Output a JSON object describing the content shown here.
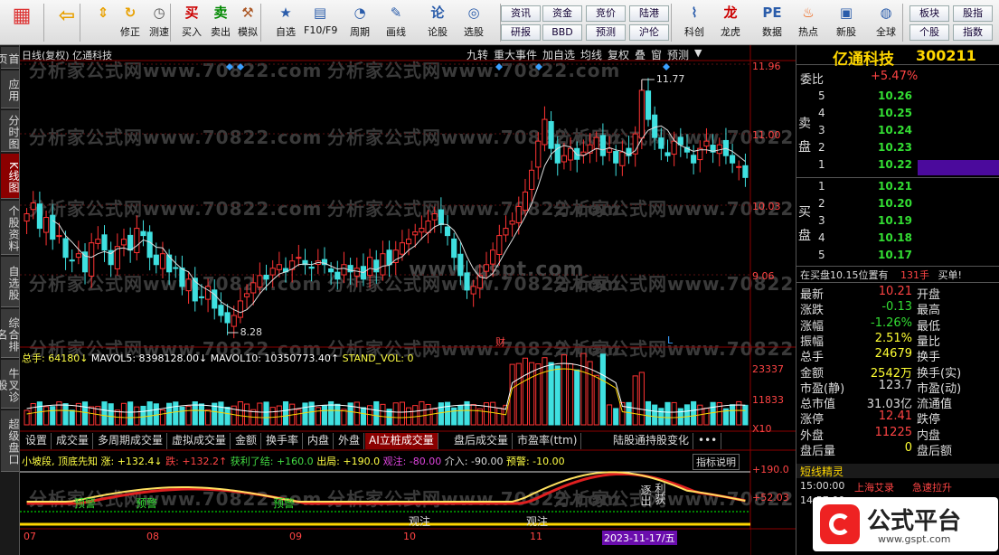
{
  "toolbar": {
    "buttons": [
      {
        "label": "",
        "icon": "grid-icon",
        "color": "#d33"
      },
      {
        "label": "",
        "icon": "back-arrow-icon",
        "color": "#e8a000"
      },
      {
        "label": "",
        "icon": "up-down-arrows-icon",
        "color": "#e8a000"
      },
      {
        "label": "修正",
        "icon": "refresh-icon",
        "color": "#e8a000"
      },
      {
        "label": "测速",
        "icon": "clock-icon",
        "color": "#555"
      },
      {
        "label": "买入",
        "icon": "buy-icon",
        "color": "#c00"
      },
      {
        "label": "卖出",
        "icon": "sell-icon",
        "color": "#080"
      },
      {
        "label": "模拟",
        "icon": "gavel-icon",
        "color": "#a52"
      },
      {
        "label": "自选",
        "icon": "star-icon",
        "color": "#2a5caa"
      },
      {
        "label": "F10/F9",
        "icon": "f10-icon",
        "color": "#2a5caa"
      },
      {
        "label": "周期",
        "icon": "cycle-icon",
        "color": "#2a5caa"
      },
      {
        "label": "画线",
        "icon": "pencil-icon",
        "color": "#2a5caa"
      },
      {
        "label": "论股",
        "icon": "chat-icon",
        "color": "#2a5caa"
      },
      {
        "label": "选股",
        "icon": "select-icon",
        "color": "#2a5caa"
      },
      {
        "label": "科创",
        "icon": "chart-icon",
        "color": "#2a5caa"
      },
      {
        "label": "龙虎",
        "icon": "dragon-icon",
        "color": "#c00"
      },
      {
        "label": "数据",
        "icon": "pe-icon",
        "color": "#2a5caa"
      },
      {
        "label": "热点",
        "icon": "fire-icon",
        "color": "#e50"
      },
      {
        "label": "新股",
        "icon": "ipo-icon",
        "color": "#2a5caa"
      },
      {
        "label": "全球",
        "icon": "globe-icon",
        "color": "#2a5caa"
      }
    ],
    "small_buttons": [
      "资讯",
      "资金",
      "竞价",
      "陆港",
      "研报",
      "BBD",
      "预测",
      "沪伦",
      "板块",
      "股指",
      "个股",
      "指数"
    ]
  },
  "left_tabs": [
    "首页",
    "应用",
    "分时图",
    "K线图",
    "个股资料",
    "自选股",
    "综合排名",
    "牛叉诊股",
    "超级盘口"
  ],
  "chart": {
    "header_left": "日线(复权)  亿通科技",
    "header_right": [
      "九转",
      "重大事件",
      "加自选",
      "均线",
      "复权",
      "叠",
      "窗",
      "预测"
    ],
    "price_axis": [
      "11.96",
      "11.00",
      "10.03",
      "9.06"
    ],
    "high_label": "11.77",
    "low_label": "8.28",
    "vol_header": {
      "a": "总手: 64180↓",
      "b": "MAVOL5: 8398128.00↓",
      "c": "MAVOL10: 10350773.40↑",
      "d": "STAND_VOL: 0"
    },
    "vol_axis": [
      "23337",
      "11833",
      "X10"
    ],
    "marker_cai": "财",
    "marker_l": "L",
    "watermark1": "分析家公式网www.70822.com",
    "watermark2": "www.gspt.com",
    "sub_tabs": [
      "设置",
      "成交量",
      "多周期成交量",
      "虚拟成交量",
      "金额",
      "换手率",
      "内盘",
      "外盘",
      "AI立桩成交量",
      "盘后成交量",
      "市盈率(ttm)",
      "陆股通持股变化",
      "•••"
    ],
    "ind_header": {
      "a": "小坡段, 顶底先知 涨: +132.4↓",
      "b": "跌: +132.2↑",
      "c": "获利了结: +160.0",
      "d": "出局: +190.0",
      "e": "观注: -80.00",
      "f": "介入: -90.00",
      "g": "预警: -10.00",
      "h": "指标说明"
    },
    "ind_axis": [
      "+190.0",
      "+52.03"
    ],
    "ind_labels": {
      "yujing": "预警",
      "guanzhu": "观注",
      "chu": "逐出",
      "zhi": "利获"
    },
    "date_axis": [
      "07",
      "08",
      "09",
      "10",
      "11"
    ],
    "current_date": "2023-11-17/五"
  },
  "candles": [
    9.9,
    10.05,
    9.7,
    9.85,
    9.55,
    9.6,
    9.3,
    9.25,
    9.35,
    9.1,
    9.5,
    9.55,
    9.4,
    9.2,
    9.45,
    9.55,
    9.4,
    9.7,
    9.6,
    9.3,
    9.2,
    9.35,
    9.1,
    9.15,
    8.9,
    9.0,
    8.7,
    8.75,
    8.9,
    8.6,
    8.5,
    8.4,
    8.5,
    8.7,
    8.8,
    8.95,
    9.05,
    9.0,
    9.15,
    9.2,
    9.1,
    9.25,
    9.3,
    9.2,
    9.15,
    9.25,
    9.2,
    9.1,
    9.0,
    9.2,
    9.1,
    9.15,
    9.0,
    9.3,
    9.1,
    9.35,
    9.2,
    9.4,
    9.5,
    9.55,
    9.65,
    9.7,
    9.8,
    9.9,
    9.75,
    9.6,
    9.3,
    9.05,
    8.85,
    8.9,
    9.05,
    9.2,
    9.4,
    9.6,
    9.7,
    9.8,
    10.0,
    10.2,
    10.5,
    10.9,
    11.2,
    10.8,
    10.6,
    10.7,
    10.8,
    10.65,
    10.75,
    10.85,
    10.95,
    10.7,
    10.8,
    10.6,
    10.75,
    10.7,
    11.0,
    11.6,
    11.2,
    10.95,
    10.8,
    10.7,
    10.9,
    10.85,
    10.75,
    10.6,
    10.8,
    10.9,
    10.75,
    10.85,
    10.7,
    10.6,
    10.55,
    10.4
  ],
  "quote": {
    "name": "亿通科技",
    "code": "300211",
    "weibi_label": "委比",
    "weibi": "+5.47%",
    "sell_label": "卖盘",
    "buy_label": "买盘",
    "asks": [
      [
        "5",
        "10.26"
      ],
      [
        "4",
        "10.25"
      ],
      [
        "3",
        "10.24"
      ],
      [
        "2",
        "10.23"
      ],
      [
        "1",
        "10.22"
      ]
    ],
    "bids": [
      [
        "1",
        "10.21"
      ],
      [
        "2",
        "10.20"
      ],
      [
        "3",
        "10.19"
      ],
      [
        "4",
        "10.18"
      ],
      [
        "5",
        "10.17"
      ]
    ],
    "info_line": {
      "a": "在买盘10.15位置有",
      "b": "131手",
      "c": "买单!"
    },
    "rows": [
      {
        "l": "最新",
        "v": "10.21",
        "vc": "#ff4444",
        "r": "开盘",
        "rv": ""
      },
      {
        "l": "涨跌",
        "v": "-0.13",
        "vc": "#33dd33",
        "r": "最高",
        "rv": ""
      },
      {
        "l": "涨幅",
        "v": "-1.26%",
        "vc": "#33dd33",
        "r": "最低",
        "rv": ""
      },
      {
        "l": "振幅",
        "v": "2.51%",
        "vc": "#ffff33",
        "r": "量比",
        "rv": ""
      },
      {
        "l": "总手",
        "v": "24679",
        "vc": "#ffff33",
        "r": "换手",
        "rv": ""
      },
      {
        "l": "金额",
        "v": "2542万",
        "vc": "#ffff33",
        "r": "换手(实)",
        "rv": ""
      },
      {
        "l": "市盈(静)",
        "v": "123.7",
        "vc": "#ddd",
        "r": "市盈(动)",
        "rv": ""
      },
      {
        "l": "总市值",
        "v": "31.03亿",
        "vc": "#ddd",
        "r": "流通值",
        "rv": ""
      },
      {
        "l": "涨停",
        "v": "12.41",
        "vc": "#ff4444",
        "r": "跌停",
        "rv": ""
      },
      {
        "l": "外盘",
        "v": "11225",
        "vc": "#ff4444",
        "r": "内盘",
        "rv": ""
      },
      {
        "l": "盘后量",
        "v": "0",
        "vc": "#ffff33",
        "r": "盘后额",
        "rv": ""
      }
    ],
    "sprite_title": "短线精灵",
    "sprite_rows": [
      {
        "t": "15:00:00",
        "n": "上海艾录",
        "e": "急速拉升"
      },
      {
        "t": "14:57:00",
        "n": "",
        "e": ""
      }
    ],
    "logo_text": "公式平台",
    "logo_url": "www.gspt.com"
  },
  "colors": {
    "up": "#ff3333",
    "down": "#3fe0e0",
    "ma5": "#ffffff",
    "ma10": "#ffd700"
  }
}
